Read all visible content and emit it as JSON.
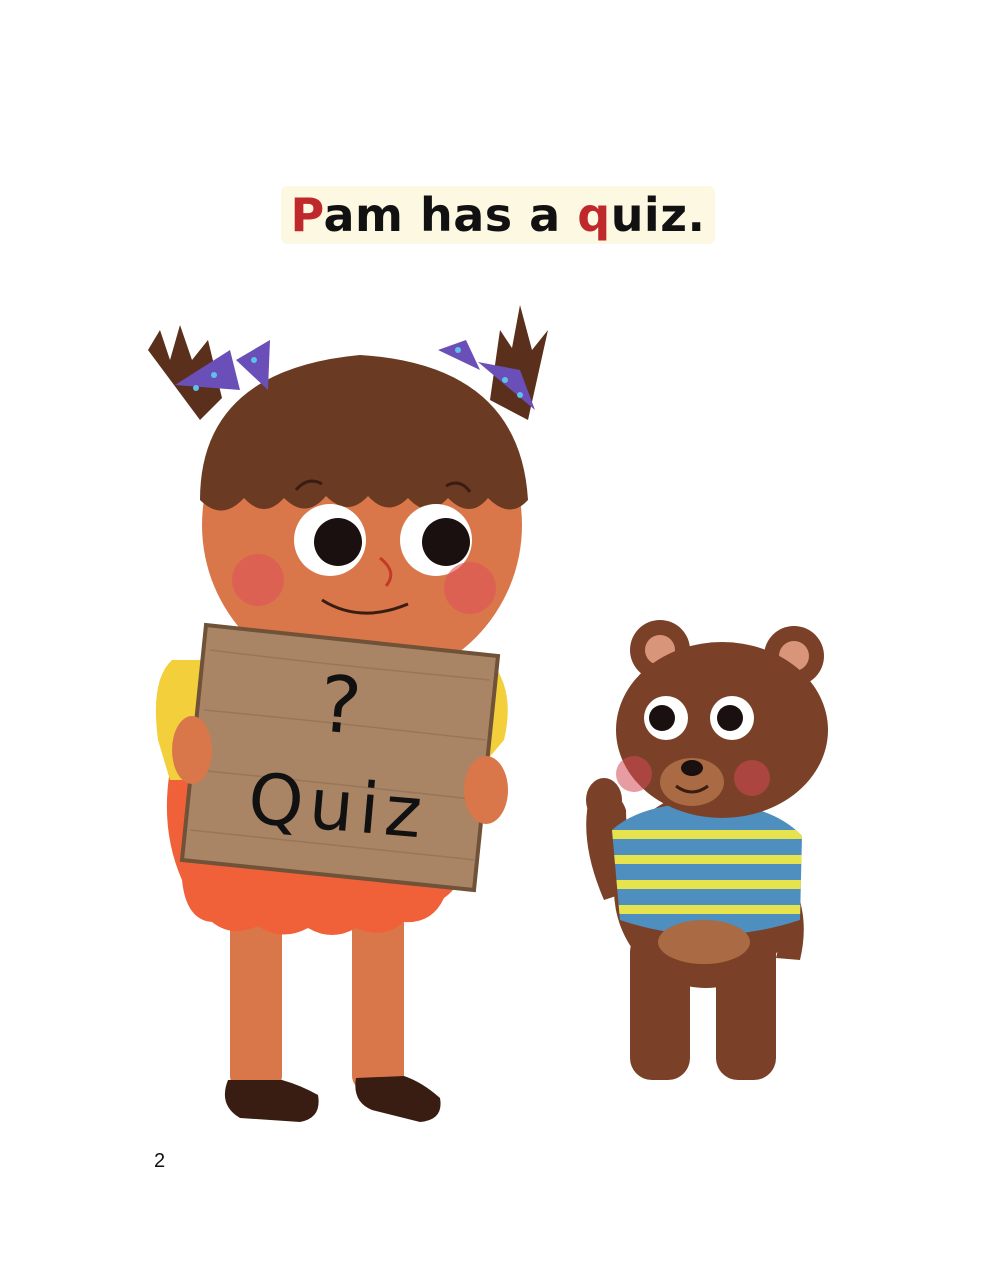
{
  "sentence": {
    "part1_highlight": "P",
    "part2": "am has a ",
    "part3_highlight": "q",
    "part4": "uiz."
  },
  "sign": {
    "question_mark": "?",
    "word": "Quiz"
  },
  "page_number": "2",
  "colors": {
    "highlight_letter": "#c0292b",
    "text": "#111111",
    "text_background": "#fdf8e2",
    "skin": "#d9774a",
    "hair": "#6a3a22",
    "bow": "#6b4fb8",
    "dress": "#f0613a",
    "shirt": "#f2cf3b",
    "sign_wood": "#a98566",
    "bear": "#7a4128",
    "bear_stripes_blue": "#4f8fc0",
    "bear_stripes_yellow": "#e7e34d"
  },
  "illustration": {
    "girl": "girl-holding-quiz-sign",
    "bear": "teddy-bear-waving"
  }
}
